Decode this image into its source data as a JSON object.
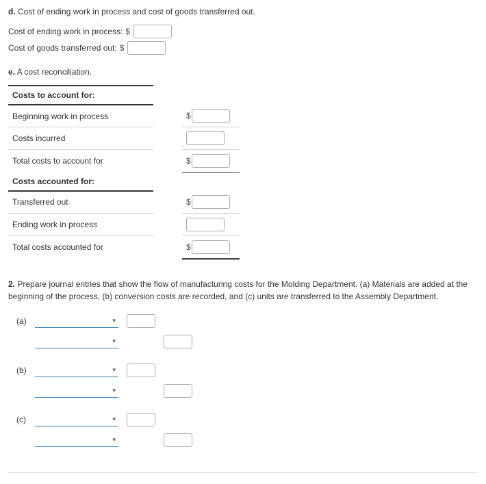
{
  "sectionD": {
    "label": "d.",
    "title": "Cost of ending work in process and cost of goods transferred out.",
    "row1Label": "Cost of ending work in process:",
    "row2Label": "Cost of goods transferred out:",
    "currency": "$"
  },
  "sectionE": {
    "label": "e.",
    "title": "A cost reconciliation."
  },
  "recon": {
    "header1": "Costs to account for:",
    "row1": "Beginning work in process",
    "row2": "Costs incurred",
    "row3": "Total costs to account for",
    "header2": "Costs accounted for:",
    "row4": "Transferred out",
    "row5": "Ending work in process",
    "row6": "Total costs accounted for",
    "currency": "$"
  },
  "q2": {
    "label": "2.",
    "text": "Prepare journal entries that show the flow of manufacturing costs for the Molding Department. (a) Materials are added at the beginning of the process, (b) conversion costs are recorded, and (c) units are transferred to the Assembly Department.",
    "a": "(a)",
    "b": "(b)",
    "c": "(c)"
  }
}
